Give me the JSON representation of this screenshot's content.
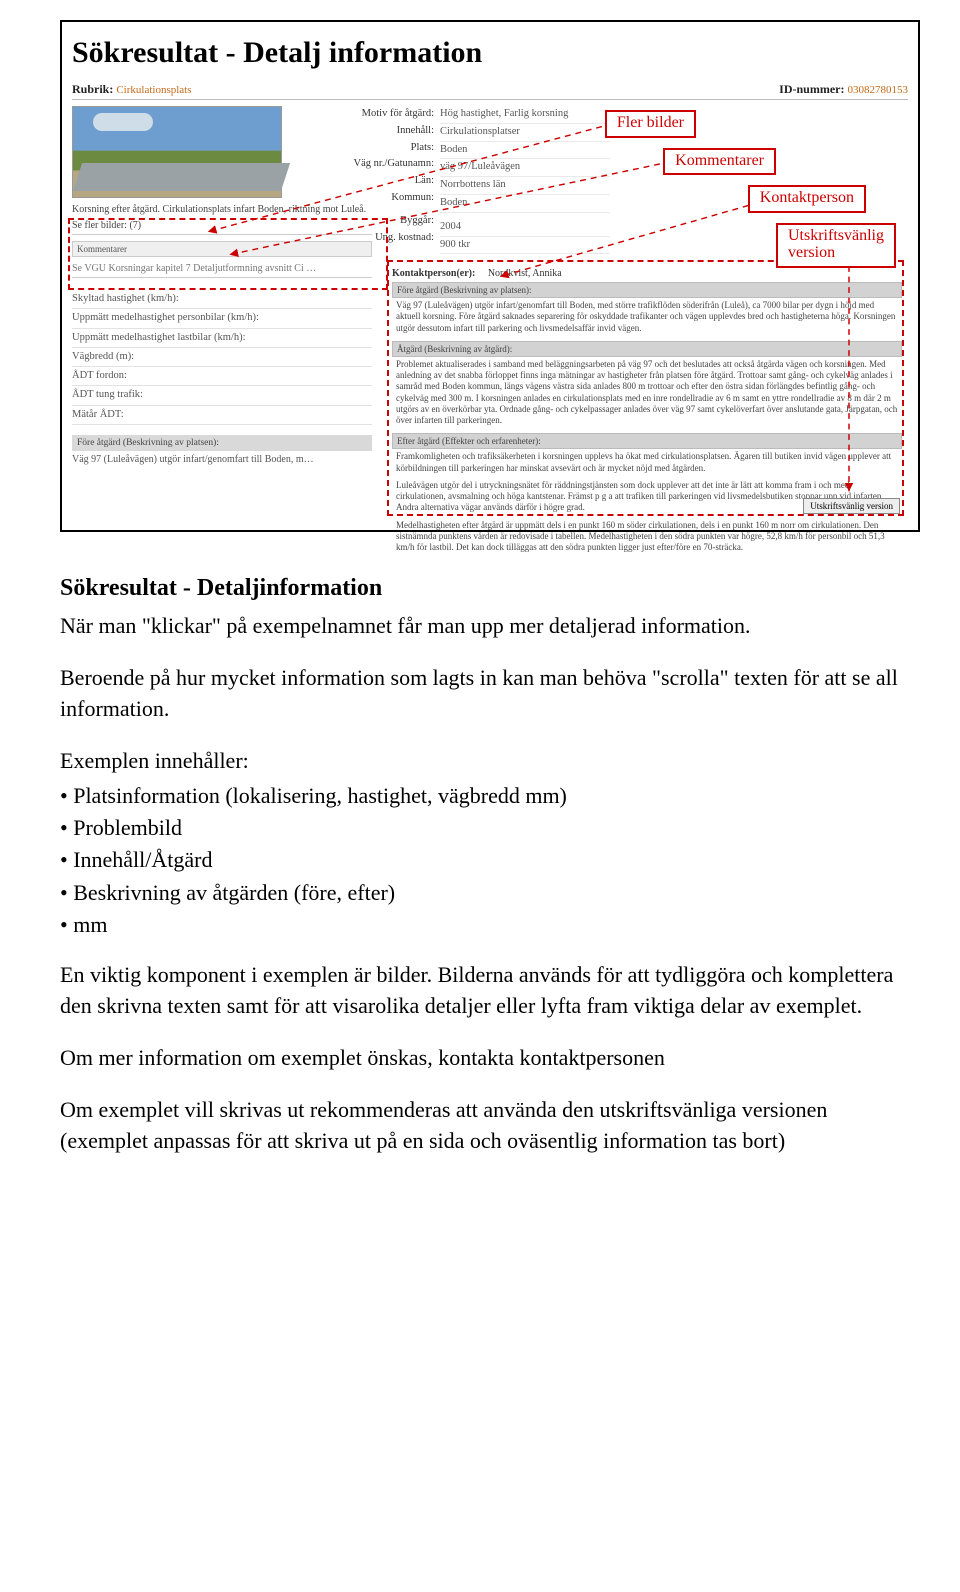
{
  "title": "Sökresultat - Detalj information",
  "header": {
    "rubrik_label": "Rubrik:",
    "rubrik_value": "Cirkulationsplats",
    "id_label": "ID-nummer:",
    "id_value": "03082780153"
  },
  "callouts": {
    "fler_bilder": "Fler bilder",
    "kommentarer": "Kommentarer",
    "kontaktperson": "Kontaktperson",
    "utskrift": "Utskriftsvänlig\nversion"
  },
  "photo_caption": "Korsning efter åtgärd. Cirkulationsplats infart Boden, riktning mot Luleå.",
  "more_images": "Se fler bilder: (7)",
  "kommentarer_tag": "Kommentarer",
  "vgu": "Se VGU Korsningar kapitel 7 Detaljutformning avsnitt Ci …",
  "fields": {
    "f1": "Skyltad hastighet (km/h):",
    "f2": "Uppmätt medelhastighet personbilar (km/h):",
    "f3": "Uppmätt medelhastighet lastbilar (km/h):",
    "f4": "Vägbredd (m):",
    "f5": "ÅDT fordon:",
    "f6": "ÅDT tung trafik:",
    "f7": "Mätår ÅDT:"
  },
  "greyhead": "Före åtgärd (Beskrivning av platsen):",
  "greyline": "Väg 97 (Luleåvägen) utgör infart/genomfart till Boden, m…",
  "center_labels": {
    "c1": "Motiv för åtgärd:",
    "c2": "Innehåll:",
    "c3": "Plats:",
    "c4": "Väg nr./Gatunamn:",
    "c5": "Län:",
    "c6": "Kommun:",
    "c7": "Byggår:",
    "c8": "Ung. kostnad:"
  },
  "center_values": {
    "v1": "Hög hastighet, Farlig korsning",
    "v2": "Cirkulationsplatser",
    "v3": "Boden",
    "v4": "väg 97/Luleåvägen",
    "v5": "Norrbottens län",
    "v6": "Boden",
    "v7": "2004",
    "v8": "900 tkr"
  },
  "kontakt_row": {
    "label": "Kontaktperson(er):",
    "value": "Nordkvist, Annika"
  },
  "blocks": {
    "h1": "Före åtgärd (Beskrivning av platsen):",
    "t1": "Väg 97 (Luleåvägen) utgör infart/genomfart till Boden, med större trafikflöden söderifrån (Luleå), ca 7000 bilar per dygn i höjd med aktuell korsning. Före åtgärd saknades separering för oskyddade trafikanter och vägen upplevdes bred och hastigheterna höga. Korsningen utgör dessutom infart till parkering och livsmedelsaffär invid vägen.",
    "h2": "Åtgärd (Beskrivning av åtgärd):",
    "t2": "Problemet aktualiserades i samband med beläggningsarbeten på väg 97 och det beslutades att också åtgärda vägen och korsningen. Med anledning av det snabba förloppet finns inga mätningar av hastigheter från platsen före åtgärd. Trottoar samt gång- och cykelväg anlades i samråd med Boden kommun, längs vägens västra sida anlades 800 m trottoar och efter den östra sidan förlängdes befintlig gång- och cykelväg med 300 m. I korsningen anlades en cirkulationsplats med en inre rondellradie av 6 m samt en yttre rondellradie av 8 m där 2 m utgörs av en överkörbar yta. Ordnade gång- och cykelpassager anlades över väg 97 samt cykelöverfart över anslutande gata, Järpgatan, och över infarten till parkeringen.",
    "h3": "Efter åtgärd (Effekter och erfarenheter):",
    "t3": "Framkomligheten och trafiksäkerheten i korsningen upplevs ha ökat med cirkulationsplatsen. Ägaren till butiken invid vägen upplever att körbildningen till parkeringen har minskat avsevärt och är mycket nöjd med åtgärden.",
    "t4": "Luleåvägen utgör del i utryckningsnätet för räddningstjänsten som dock upplever att det inte är lätt att komma fram i och med cirkulationen, avsmalning och höga kantstenar. Främst p g a att trafiken till parkeringen vid livsmedelsbutiken stoppar upp vid infarten. Andra alternativa vägar används därför i högre grad.",
    "t5": "Medelhastigheten efter åtgärd är uppmätt dels i en punkt 160 m söder cirkulationen, dels i en punkt 160 m norr om cirkulationen. Den sistnämnda punktens värden är redovisade i tabellen. Medelhastigheten i den södra punkten var högre, 52,8 km/h för personbil och 51,3 km/h för lastbil. Det kan dock tilläggas att den södra punkten ligger just efter/före en 70-sträcka."
  },
  "printbtn": "Utskriftsvänlig version",
  "body": {
    "h": "Sökresultat  - Detaljinformation",
    "p1": "När man \"klickar\" på exempelnamnet får man upp mer detaljerad information.",
    "p2": "Beroende på hur mycket information som lagts in kan man behöva \"scrolla\" texten för att se all information.",
    "lead": "Exemplen innehåller:",
    "li1": "Platsinformation (lokalisering, hastighet, vägbredd mm)",
    "li2": "Problembild",
    "li3": "Innehåll/Åtgärd",
    "li4": "Beskrivning av åtgärden (före, efter)",
    "li5": "mm",
    "p3": "En viktig komponent i exemplen är bilder. Bilderna används för att tydliggöra och komplettera den skrivna texten samt för att visarolika detaljer eller lyfta fram viktiga delar  av exemplet.",
    "p4": "Om mer information om exemplet önskas, kontakta kontaktpersonen",
    "p5": "Om exemplet vill skrivas ut rekommenderas att använda den utskriftsvänliga versionen (exemplet anpassas för att skriva ut på en sida och oväsentlig information tas bort)"
  }
}
